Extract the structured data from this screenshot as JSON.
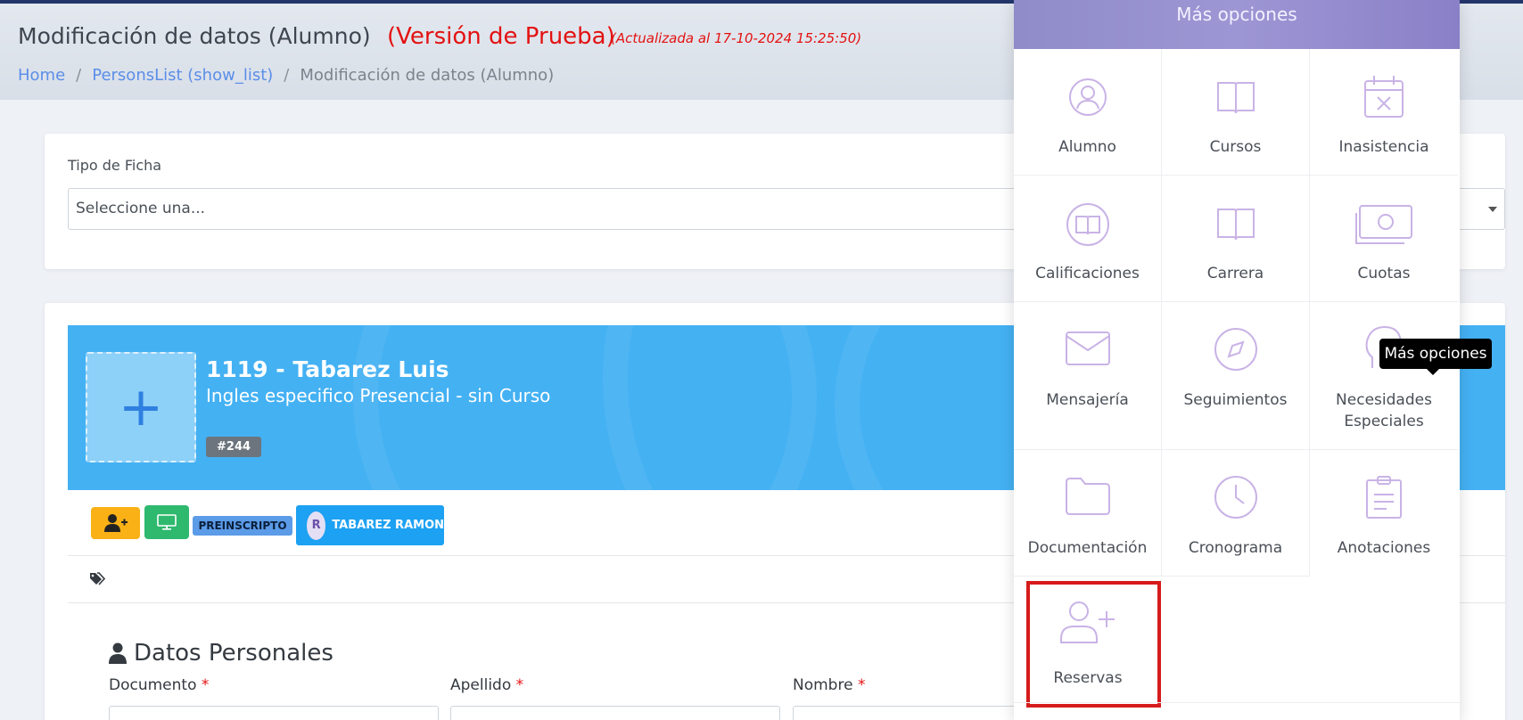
{
  "header": {
    "title": "Modificación de datos (Alumno)",
    "test_version": "(Versión de Prueba)",
    "updated": "(Actualizada al 17-10-2024 15:25:50)"
  },
  "breadcrumb": {
    "home": "Home",
    "list": "PersonsList (show_list)",
    "current": "Modificación de datos (Alumno)",
    "separator": "/"
  },
  "tipo_ficha": {
    "label": "Tipo de Ficha",
    "value": "Seleccione una..."
  },
  "student": {
    "name": "1119 - Tabarez Luis",
    "course": "Ingles especifico Presencial - sin Curso",
    "id_badge": "#244",
    "status_badge": "PREINSCRIPTO",
    "relative_initial": "R",
    "relative_name": "TABAREZ RAMON"
  },
  "section": {
    "title": "Datos Personales",
    "fields": [
      {
        "label": "Documento",
        "required": "*"
      },
      {
        "label": "Apellido",
        "required": "*"
      },
      {
        "label": "Nombre",
        "required": "*"
      }
    ]
  },
  "menu": {
    "title": "Más opciones",
    "items": [
      {
        "label": "Alumno",
        "icon": "user-circle-icon"
      },
      {
        "label": "Cursos",
        "icon": "book-open-icon"
      },
      {
        "label": "Inasistencia",
        "icon": "calendar-x-icon"
      },
      {
        "label": "Calificaciones",
        "icon": "book-circle-icon"
      },
      {
        "label": "Carrera",
        "icon": "book-icon"
      },
      {
        "label": "Cuotas",
        "icon": "money-icon"
      },
      {
        "label": "Mensajería",
        "icon": "envelope-icon"
      },
      {
        "label": "Seguimientos",
        "icon": "compass-icon"
      },
      {
        "label": "Necesidades Especiales",
        "icon": "head-icon"
      },
      {
        "label": "Documentación",
        "icon": "folder-icon"
      },
      {
        "label": "Cronograma",
        "icon": "clock-icon"
      },
      {
        "label": "Anotaciones",
        "icon": "clipboard-icon"
      },
      {
        "label": "Reservas",
        "icon": "user-plus-icon"
      }
    ]
  },
  "tooltip": "Más opciones",
  "colors": {
    "accent": "#1da1f2",
    "banner": "#44b1f3",
    "test_red": "#e31212",
    "icon_purple": "#c9b3e6",
    "selection": "#d61b1b"
  }
}
